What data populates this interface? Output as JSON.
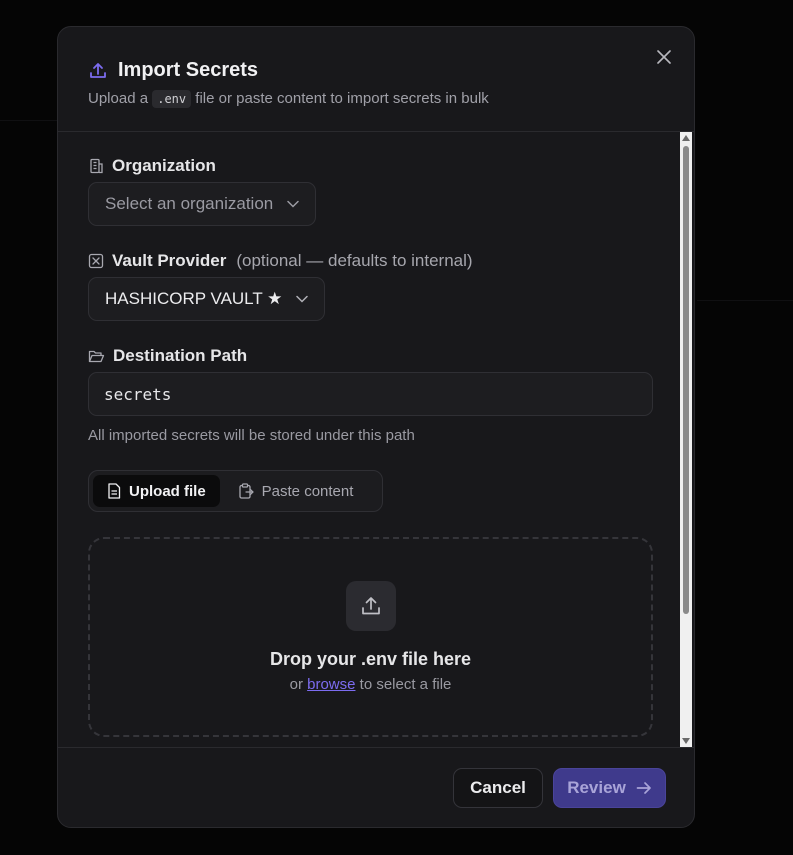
{
  "modal": {
    "title": "Import Secrets",
    "subtitle_prefix": "Upload a",
    "subtitle_code": ".env",
    "subtitle_suffix": "file or paste content to import secrets in bulk",
    "close_icon": "close-icon"
  },
  "organization": {
    "label": "Organization",
    "placeholder": "Select an organization",
    "icon": "building-icon"
  },
  "vault_provider": {
    "label": "Vault Provider",
    "optional_note": "(optional — defaults to internal)",
    "selected": "HASHICORP VAULT ★",
    "icon": "vault-icon"
  },
  "destination": {
    "label": "Destination Path",
    "value": "secrets",
    "hint": "All imported secrets will be stored under this path",
    "icon": "folder-open-icon"
  },
  "mode_tabs": [
    {
      "label": "Upload file",
      "active": true,
      "icon": "file-text-icon"
    },
    {
      "label": "Paste content",
      "active": false,
      "icon": "clipboard-icon"
    }
  ],
  "dropzone": {
    "title": "Drop your .env file here",
    "sub_prefix": "or",
    "browse_link": "browse",
    "sub_suffix": "to select a file",
    "icon": "upload-icon"
  },
  "footer": {
    "cancel_label": "Cancel",
    "review_label": "Review"
  },
  "colors": {
    "accent": "#7c6cf0",
    "review_bg": "#3f3a8c",
    "modal_bg": "#18181b"
  }
}
